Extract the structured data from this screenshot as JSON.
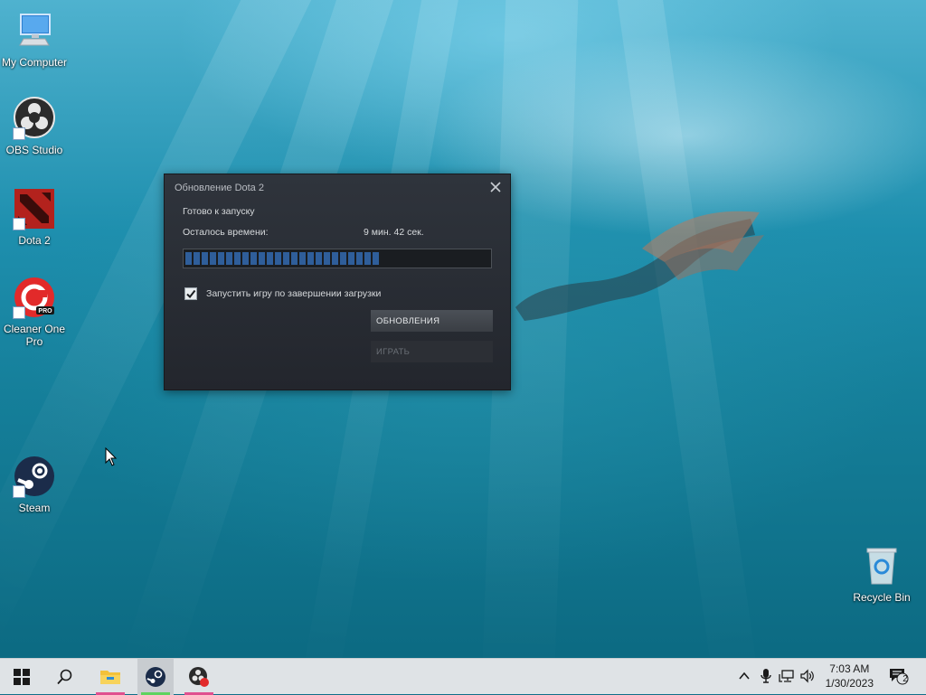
{
  "desktop": {
    "icons": [
      {
        "label": "My Computer"
      },
      {
        "label": "OBS Studio"
      },
      {
        "label": "Dota 2"
      },
      {
        "label": "Cleaner One Pro"
      },
      {
        "label": "Steam"
      },
      {
        "label": "Recycle Bin"
      }
    ]
  },
  "dialog": {
    "title": "Обновление Dota 2",
    "status": "Готово к запуску",
    "time_remaining_label": "Осталось времени:",
    "time_remaining_value": "9 мин. 42 сек.",
    "progress_fraction": 0.64,
    "launch_checkbox_label": "Запустить игру по завершении загрузки",
    "launch_checkbox_checked": true,
    "updates_button": "ОБНОВЛЕНИЯ",
    "play_button": "ИГРАТЬ"
  },
  "taskbar": {
    "clock_time": "7:03 AM",
    "clock_date": "1/30/2023",
    "notification_count": "2"
  },
  "colors": {
    "accent_underline": "#e0508f",
    "steam_active_underline": "#5fd35f",
    "progress_fill": "#2f5e9a",
    "dialog_bg": "#2a2e35"
  }
}
